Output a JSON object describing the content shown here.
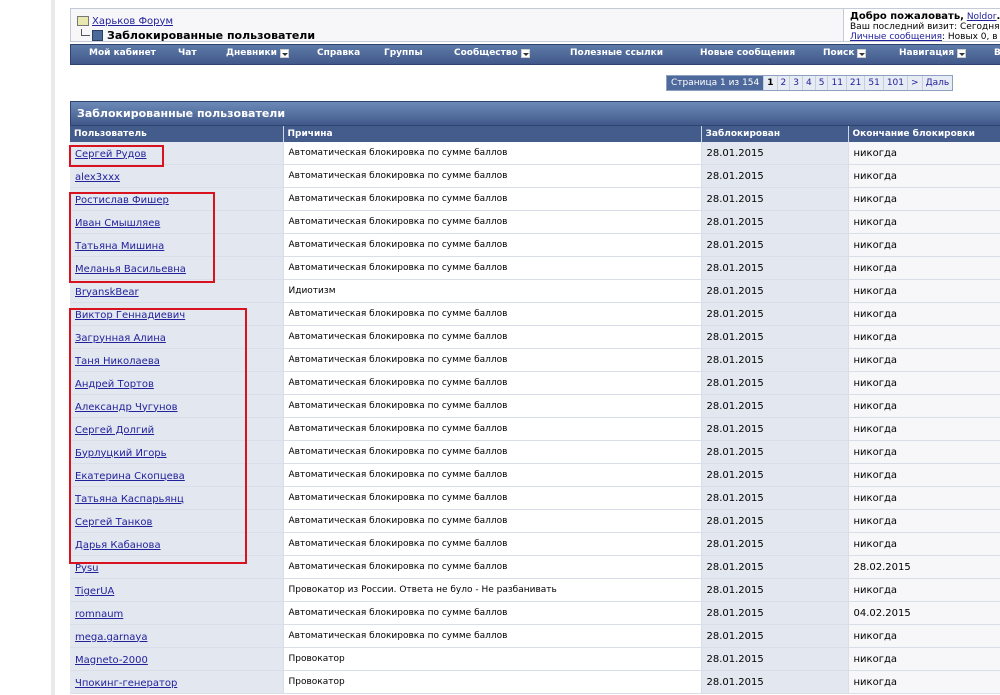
{
  "breadcrumb": {
    "forum_link": "Харьков Форум",
    "page_title": "Заблокированные пользователи"
  },
  "welcome": {
    "greeting": "Добро пожаловать,",
    "username": "Noldor",
    "last_visit": "Ваш последний визит: Сегодня",
    "pm_link": "Личные сообщения",
    "pm_text": ": Новых 0, в"
  },
  "navbar": [
    {
      "label": "Мой кабинет",
      "arrow": false
    },
    {
      "label": "Чат",
      "arrow": false
    },
    {
      "label": "Дневники",
      "arrow": true
    },
    {
      "label": "Справка",
      "arrow": false
    },
    {
      "label": "Группы",
      "arrow": false
    },
    {
      "label": "Сообщество",
      "arrow": true
    },
    {
      "label": "Полезные ссылки",
      "arrow": false
    },
    {
      "label": "Новые сообщения",
      "arrow": false
    },
    {
      "label": "Поиск",
      "arrow": true
    },
    {
      "label": "Навигация",
      "arrow": true
    },
    {
      "label": "В",
      "arrow": false
    }
  ],
  "pager": {
    "label": "Страница 1 из 154",
    "current": "1",
    "pages": [
      "2",
      "3",
      "4",
      "5",
      "11",
      "21",
      "51",
      "101",
      ">",
      "Даль"
    ]
  },
  "table": {
    "caption": "Заблокированные пользователи",
    "headers": [
      "Пользователь",
      "Причина",
      "Заблокирован",
      "Окончание блокировки"
    ],
    "rows": [
      {
        "user": "Сергей Рудов",
        "reason": "Автоматическая блокировка по сумме баллов",
        "date": "28.01.2015",
        "end": "никогда"
      },
      {
        "user": "alex3xxx",
        "reason": "Автоматическая блокировка по сумме баллов",
        "date": "28.01.2015",
        "end": "никогда"
      },
      {
        "user": "Ростислав Фишер",
        "reason": "Автоматическая блокировка по сумме баллов",
        "date": "28.01.2015",
        "end": "никогда"
      },
      {
        "user": "Иван Смышляев",
        "reason": "Автоматическая блокировка по сумме баллов",
        "date": "28.01.2015",
        "end": "никогда"
      },
      {
        "user": "Татьяна Мишина",
        "reason": "Автоматическая блокировка по сумме баллов",
        "date": "28.01.2015",
        "end": "никогда"
      },
      {
        "user": "Меланья Васильевна",
        "reason": "Автоматическая блокировка по сумме баллов",
        "date": "28.01.2015",
        "end": "никогда"
      },
      {
        "user": "BryanskBear",
        "reason": "Идиотизм",
        "date": "28.01.2015",
        "end": "никогда"
      },
      {
        "user": "Виктор Геннадиевич",
        "reason": "Автоматическая блокировка по сумме баллов",
        "date": "28.01.2015",
        "end": "никогда"
      },
      {
        "user": "Загрунная Алина",
        "reason": "Автоматическая блокировка по сумме баллов",
        "date": "28.01.2015",
        "end": "никогда"
      },
      {
        "user": "Таня Николаева",
        "reason": "Автоматическая блокировка по сумме баллов",
        "date": "28.01.2015",
        "end": "никогда"
      },
      {
        "user": "Андрей Тортов",
        "reason": "Автоматическая блокировка по сумме баллов",
        "date": "28.01.2015",
        "end": "никогда"
      },
      {
        "user": "Александр Чугунов",
        "reason": "Автоматическая блокировка по сумме баллов",
        "date": "28.01.2015",
        "end": "никогда"
      },
      {
        "user": "Сергей Долгий",
        "reason": "Автоматическая блокировка по сумме баллов",
        "date": "28.01.2015",
        "end": "никогда"
      },
      {
        "user": "Бурлуцкий Игорь",
        "reason": "Автоматическая блокировка по сумме баллов",
        "date": "28.01.2015",
        "end": "никогда"
      },
      {
        "user": "Екатерина Скопцева",
        "reason": "Автоматическая блокировка по сумме баллов",
        "date": "28.01.2015",
        "end": "никогда"
      },
      {
        "user": "Татьяна Каспарьянц",
        "reason": "Автоматическая блокировка по сумме баллов",
        "date": "28.01.2015",
        "end": "никогда"
      },
      {
        "user": "Сергей Танков",
        "reason": "Автоматическая блокировка по сумме баллов",
        "date": "28.01.2015",
        "end": "никогда"
      },
      {
        "user": "Дарья Кабанова",
        "reason": "Автоматическая блокировка по сумме баллов",
        "date": "28.01.2015",
        "end": "никогда"
      },
      {
        "user": "Pysu",
        "reason": "Автоматическая блокировка по сумме баллов",
        "date": "28.01.2015",
        "end": "28.02.2015"
      },
      {
        "user": "TigerUA",
        "reason": "Провокатор из России. Ответа не було - Не разбанивать",
        "date": "28.01.2015",
        "end": "никогда"
      },
      {
        "user": "romnaum",
        "reason": "Автоматическая блокировка по сумме баллов",
        "date": "28.01.2015",
        "end": "04.02.2015"
      },
      {
        "user": "mega.garnaya",
        "reason": "Автоматическая блокировка по сумме баллов",
        "date": "28.01.2015",
        "end": "никогда"
      },
      {
        "user": "Magneto-2000",
        "reason": "Провокатор",
        "date": "28.01.2015",
        "end": "никогда"
      },
      {
        "user": "Чпокинг-генератор",
        "reason": "Провокатор",
        "date": "28.01.2015",
        "end": "никогда"
      }
    ]
  },
  "highlight_color": "#d8121f"
}
